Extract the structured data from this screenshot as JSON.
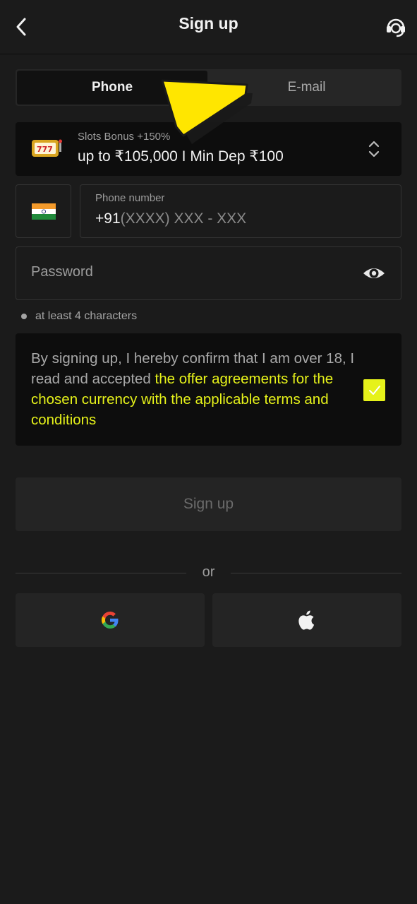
{
  "header": {
    "title": "Sign up",
    "back_icon": "chevron-left-icon",
    "support_icon": "headset-support-icon"
  },
  "tabs": [
    {
      "label": "Phone",
      "active": true
    },
    {
      "label": "E-mail",
      "active": false
    }
  ],
  "bonus": {
    "subtitle": "Slots Bonus +150%",
    "title": "up to ₹105,000 I Min Dep ₹100",
    "icon": "slot-machine-icon"
  },
  "phone": {
    "country_flag": "india-flag-icon",
    "label": "Phone number",
    "prefix": "+91",
    "mask": "(XXXX) XXX - XXX"
  },
  "password": {
    "placeholder": "Password",
    "hint": "at least 4 characters"
  },
  "terms": {
    "text": "By signing up, I hereby confirm that I am over 18, I read and accepted ",
    "link": "the offer agreements for the chosen currency with the applicable terms and conditions",
    "checked": true
  },
  "signup_button": "Sign up",
  "divider_text": "or",
  "colors": {
    "accent": "#e6f21a",
    "background": "#1b1b1b",
    "panel": "#0d0d0d"
  }
}
